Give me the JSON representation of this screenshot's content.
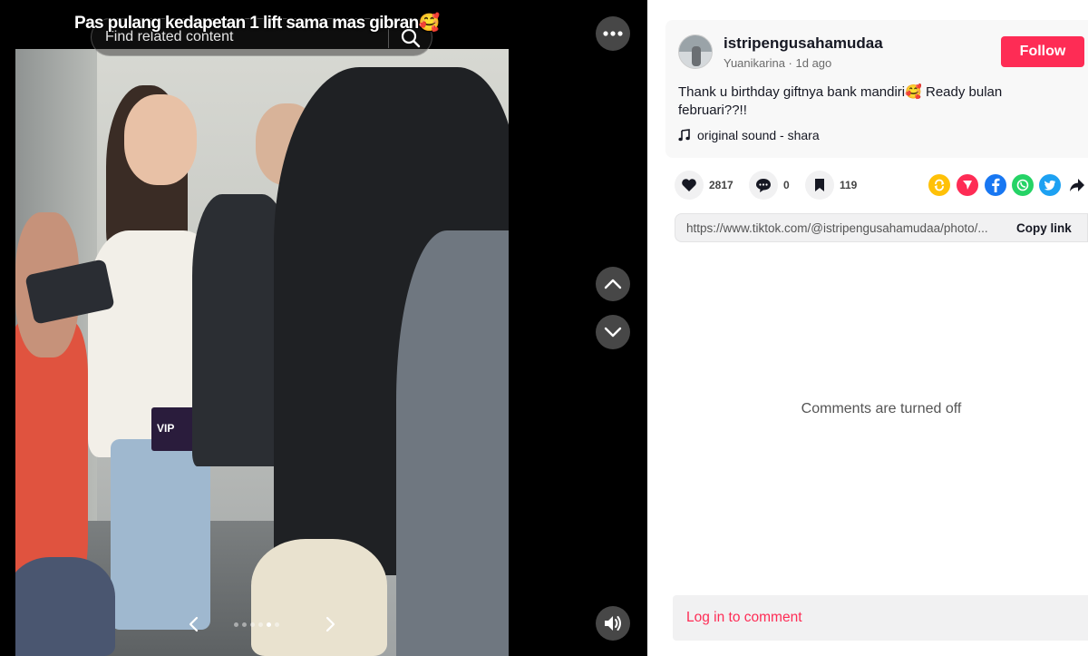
{
  "post": {
    "caption": "Pas pulang kedapetan 1 lift sama mas gibran🥰",
    "photo_overlay_text": "VIP",
    "carousel": {
      "dot_count": 6,
      "active_index": 4
    }
  },
  "search": {
    "placeholder": "Find related content"
  },
  "author": {
    "username": "istripengusahamudaa",
    "meta": "Yuanikarina · 1d ago",
    "follow_label": "Follow"
  },
  "description": "Thank u birthday giftnya bank mandiri🥰  Ready bulan februari??!!",
  "sound": {
    "label": "original sound - shara"
  },
  "stats": {
    "likes": "2817",
    "comments": "0",
    "saves": "119"
  },
  "share_icons": [
    "repost-icon",
    "send-icon",
    "facebook-icon",
    "whatsapp-icon",
    "twitter-icon",
    "share-arrow-icon"
  ],
  "link": {
    "url": "https://www.tiktok.com/@istripengusahamudaa/photo/...",
    "copy_label": "Copy link"
  },
  "comments": {
    "status": "Comments are turned off",
    "login_label": "Log in to comment"
  },
  "colors": {
    "accent": "#fe2c55",
    "repost": "#ffc107",
    "send": "#fe2c55",
    "facebook": "#1877f2",
    "whatsapp": "#25d366",
    "twitter": "#1da1f2"
  }
}
